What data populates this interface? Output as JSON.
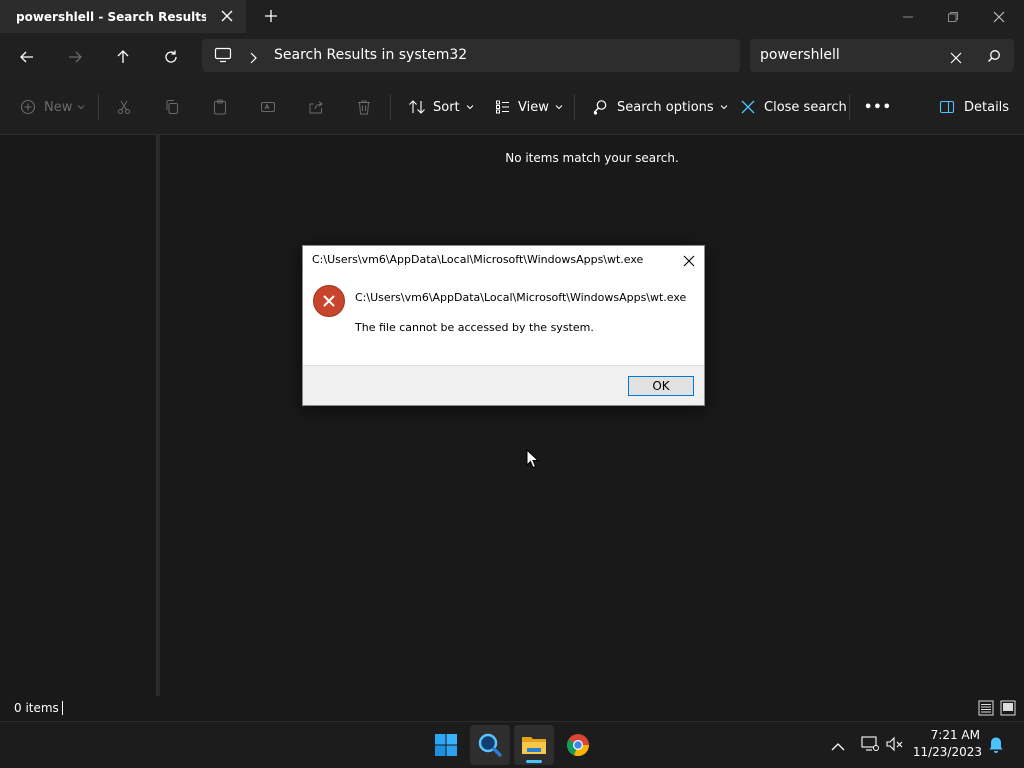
{
  "tab": {
    "title": "powershlell - Search Results in syst",
    "close_icon": "close-icon",
    "new_tab_icon": "plus-icon"
  },
  "window": {
    "minimize_icon": "minimize-icon",
    "restore_icon": "restore-icon",
    "close_icon": "close-icon"
  },
  "nav": {
    "back_icon": "arrow-left-icon",
    "forward_icon": "arrow-right-icon",
    "up_icon": "arrow-up-icon",
    "refresh_icon": "refresh-icon",
    "address": {
      "computer_icon": "monitor-icon",
      "chevron_icon": "chevron-right-icon",
      "path": "Search Results in system32"
    },
    "search": {
      "value": "powershlell",
      "clear_icon": "close-icon",
      "search_icon": "search-icon"
    }
  },
  "commands": {
    "new_label": "New",
    "sort_label": "Sort",
    "view_label": "View",
    "search_options_label": "Search options",
    "close_search_label": "Close search",
    "more_label": "•••",
    "details_label": "Details"
  },
  "content": {
    "empty_message": "No items match your search."
  },
  "status": {
    "items": "0 items"
  },
  "dialog": {
    "title": "C:\\Users\\vm6\\AppData\\Local\\Microsoft\\WindowsApps\\wt.exe",
    "path": "C:\\Users\\vm6\\AppData\\Local\\Microsoft\\WindowsApps\\wt.exe",
    "message": "The file cannot be accessed by the system.",
    "ok_label": "OK",
    "icon": "error-icon"
  },
  "taskbar": {
    "apps": [
      "start-icon",
      "search-app-icon",
      "file-explorer-icon",
      "chrome-icon"
    ],
    "time": "7:21 AM",
    "date": "11/23/2023"
  },
  "colors": {
    "accent": "#4cc2ff",
    "error": "#c8452d",
    "folder": "#f0b429"
  }
}
